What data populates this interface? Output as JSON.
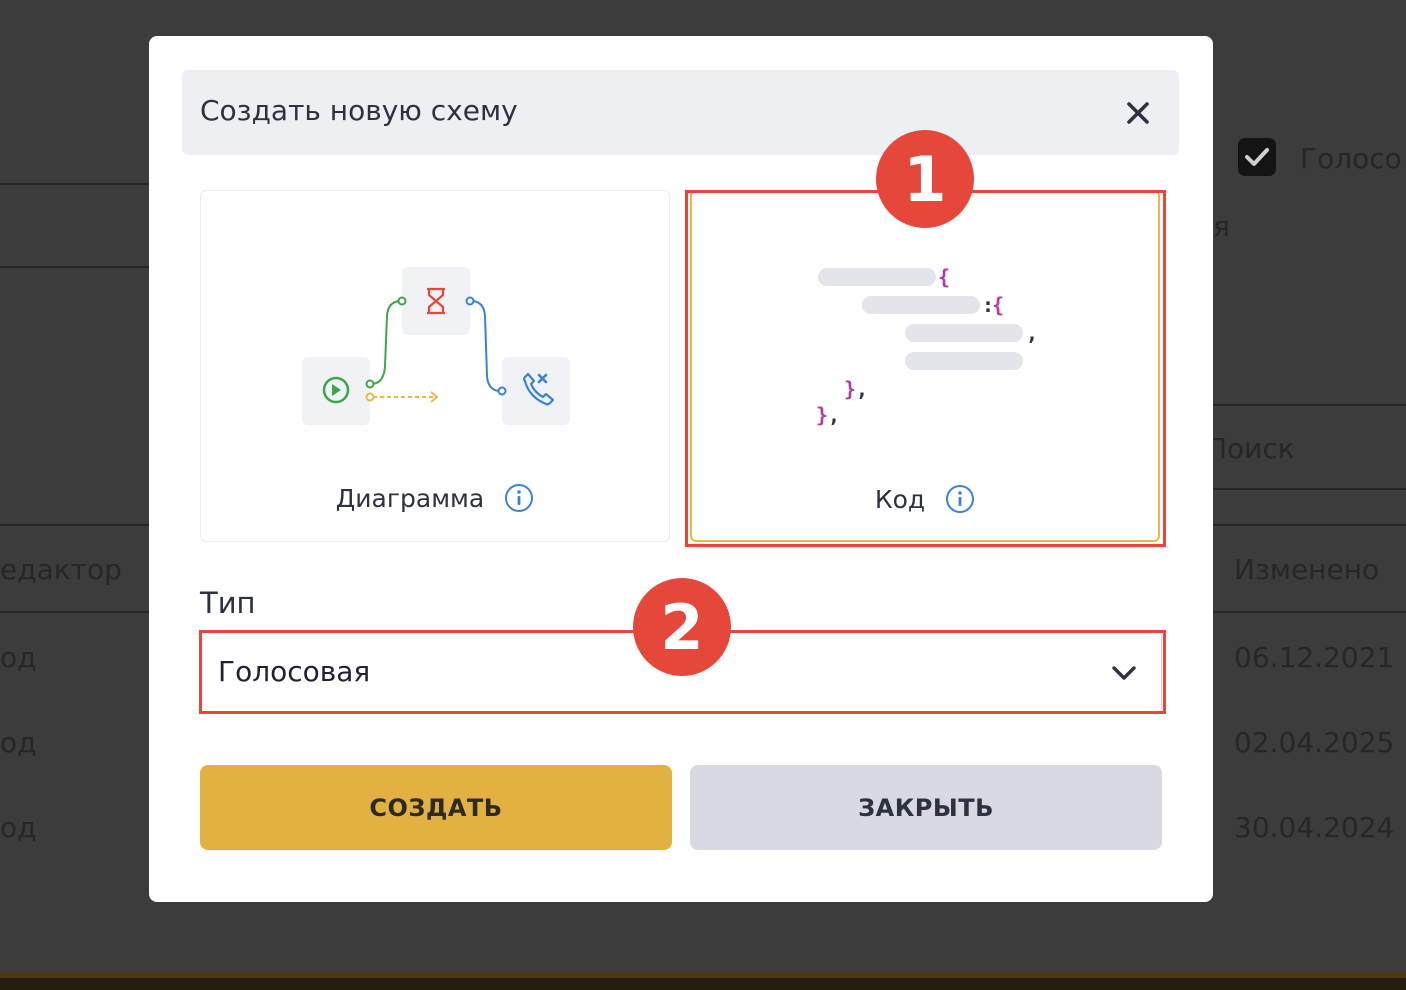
{
  "background": {
    "checkbox_label": "Голосо",
    "partial_text": "я",
    "search_placeholder": "Поиск",
    "column_editor": "едактор",
    "column_modified": "Изменено",
    "rows": [
      {
        "editor": "од",
        "modified": "06.12.2021"
      },
      {
        "editor": "од",
        "modified": "02.04.2025"
      },
      {
        "editor": "од",
        "modified": "30.04.2024"
      }
    ]
  },
  "modal": {
    "title": "Создать новую схему",
    "close_icon": "close-icon",
    "cards": [
      {
        "label": "Диаграмма",
        "icon": "info-icon"
      },
      {
        "label": "Код",
        "icon": "info-icon"
      }
    ],
    "type_label": "Тип",
    "type_value": "Голосовая",
    "create_label": "СОЗДАТЬ",
    "close_label": "ЗАКРЫТЬ"
  },
  "annotations": {
    "badge_1": "1",
    "badge_2": "2"
  },
  "colors": {
    "accent": "#e3b142",
    "annotation": "#e5483a",
    "secondary_button": "#d8d9e3",
    "info": "#3b82d6"
  }
}
